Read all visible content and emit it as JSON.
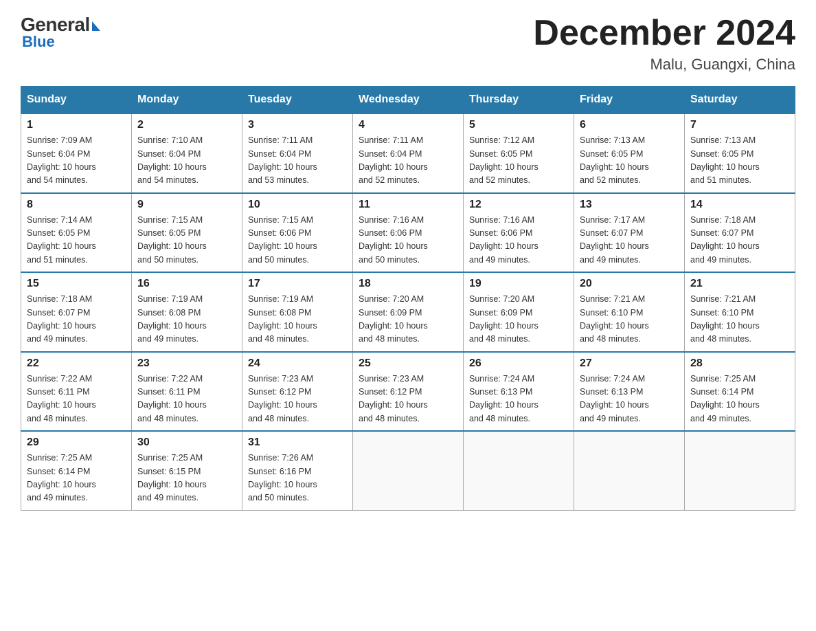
{
  "logo": {
    "general": "General",
    "blue": "Blue"
  },
  "header": {
    "month": "December 2024",
    "location": "Malu, Guangxi, China"
  },
  "weekdays": [
    "Sunday",
    "Monday",
    "Tuesday",
    "Wednesday",
    "Thursday",
    "Friday",
    "Saturday"
  ],
  "weeks": [
    [
      {
        "day": "1",
        "sunrise": "7:09 AM",
        "sunset": "6:04 PM",
        "daylight": "10 hours and 54 minutes."
      },
      {
        "day": "2",
        "sunrise": "7:10 AM",
        "sunset": "6:04 PM",
        "daylight": "10 hours and 54 minutes."
      },
      {
        "day": "3",
        "sunrise": "7:11 AM",
        "sunset": "6:04 PM",
        "daylight": "10 hours and 53 minutes."
      },
      {
        "day": "4",
        "sunrise": "7:11 AM",
        "sunset": "6:04 PM",
        "daylight": "10 hours and 52 minutes."
      },
      {
        "day": "5",
        "sunrise": "7:12 AM",
        "sunset": "6:05 PM",
        "daylight": "10 hours and 52 minutes."
      },
      {
        "day": "6",
        "sunrise": "7:13 AM",
        "sunset": "6:05 PM",
        "daylight": "10 hours and 52 minutes."
      },
      {
        "day": "7",
        "sunrise": "7:13 AM",
        "sunset": "6:05 PM",
        "daylight": "10 hours and 51 minutes."
      }
    ],
    [
      {
        "day": "8",
        "sunrise": "7:14 AM",
        "sunset": "6:05 PM",
        "daylight": "10 hours and 51 minutes."
      },
      {
        "day": "9",
        "sunrise": "7:15 AM",
        "sunset": "6:05 PM",
        "daylight": "10 hours and 50 minutes."
      },
      {
        "day": "10",
        "sunrise": "7:15 AM",
        "sunset": "6:06 PM",
        "daylight": "10 hours and 50 minutes."
      },
      {
        "day": "11",
        "sunrise": "7:16 AM",
        "sunset": "6:06 PM",
        "daylight": "10 hours and 50 minutes."
      },
      {
        "day": "12",
        "sunrise": "7:16 AM",
        "sunset": "6:06 PM",
        "daylight": "10 hours and 49 minutes."
      },
      {
        "day": "13",
        "sunrise": "7:17 AM",
        "sunset": "6:07 PM",
        "daylight": "10 hours and 49 minutes."
      },
      {
        "day": "14",
        "sunrise": "7:18 AM",
        "sunset": "6:07 PM",
        "daylight": "10 hours and 49 minutes."
      }
    ],
    [
      {
        "day": "15",
        "sunrise": "7:18 AM",
        "sunset": "6:07 PM",
        "daylight": "10 hours and 49 minutes."
      },
      {
        "day": "16",
        "sunrise": "7:19 AM",
        "sunset": "6:08 PM",
        "daylight": "10 hours and 49 minutes."
      },
      {
        "day": "17",
        "sunrise": "7:19 AM",
        "sunset": "6:08 PM",
        "daylight": "10 hours and 48 minutes."
      },
      {
        "day": "18",
        "sunrise": "7:20 AM",
        "sunset": "6:09 PM",
        "daylight": "10 hours and 48 minutes."
      },
      {
        "day": "19",
        "sunrise": "7:20 AM",
        "sunset": "6:09 PM",
        "daylight": "10 hours and 48 minutes."
      },
      {
        "day": "20",
        "sunrise": "7:21 AM",
        "sunset": "6:10 PM",
        "daylight": "10 hours and 48 minutes."
      },
      {
        "day": "21",
        "sunrise": "7:21 AM",
        "sunset": "6:10 PM",
        "daylight": "10 hours and 48 minutes."
      }
    ],
    [
      {
        "day": "22",
        "sunrise": "7:22 AM",
        "sunset": "6:11 PM",
        "daylight": "10 hours and 48 minutes."
      },
      {
        "day": "23",
        "sunrise": "7:22 AM",
        "sunset": "6:11 PM",
        "daylight": "10 hours and 48 minutes."
      },
      {
        "day": "24",
        "sunrise": "7:23 AM",
        "sunset": "6:12 PM",
        "daylight": "10 hours and 48 minutes."
      },
      {
        "day": "25",
        "sunrise": "7:23 AM",
        "sunset": "6:12 PM",
        "daylight": "10 hours and 48 minutes."
      },
      {
        "day": "26",
        "sunrise": "7:24 AM",
        "sunset": "6:13 PM",
        "daylight": "10 hours and 48 minutes."
      },
      {
        "day": "27",
        "sunrise": "7:24 AM",
        "sunset": "6:13 PM",
        "daylight": "10 hours and 49 minutes."
      },
      {
        "day": "28",
        "sunrise": "7:25 AM",
        "sunset": "6:14 PM",
        "daylight": "10 hours and 49 minutes."
      }
    ],
    [
      {
        "day": "29",
        "sunrise": "7:25 AM",
        "sunset": "6:14 PM",
        "daylight": "10 hours and 49 minutes."
      },
      {
        "day": "30",
        "sunrise": "7:25 AM",
        "sunset": "6:15 PM",
        "daylight": "10 hours and 49 minutes."
      },
      {
        "day": "31",
        "sunrise": "7:26 AM",
        "sunset": "6:16 PM",
        "daylight": "10 hours and 50 minutes."
      },
      null,
      null,
      null,
      null
    ]
  ],
  "labels": {
    "sunrise": "Sunrise:",
    "sunset": "Sunset:",
    "daylight": "Daylight:"
  }
}
